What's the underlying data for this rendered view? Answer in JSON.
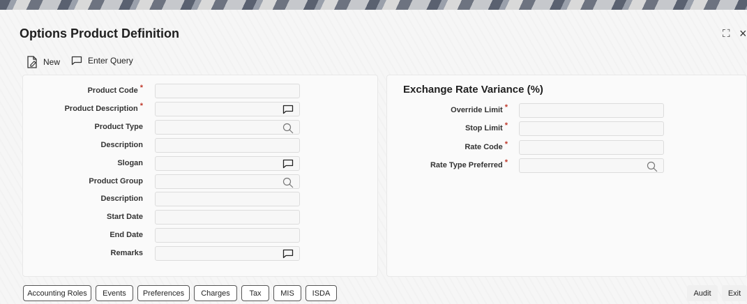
{
  "window": {
    "title": "Options Product Definition",
    "maximize_glyph": "⛶",
    "close_glyph": "×"
  },
  "toolbar": {
    "new_label": "New",
    "enter_query_label": "Enter Query"
  },
  "left_panel": {
    "fields": [
      {
        "label": "Product Code",
        "required": true,
        "icon": null
      },
      {
        "label": "Product Description",
        "required": true,
        "icon": "comment-icon"
      },
      {
        "label": "Product Type",
        "required": false,
        "icon": "search-icon"
      },
      {
        "label": "Description",
        "required": false,
        "icon": null
      },
      {
        "label": "Slogan",
        "required": false,
        "icon": "comment-icon"
      },
      {
        "label": "Product Group",
        "required": false,
        "icon": "search-icon"
      },
      {
        "label": "Description",
        "required": false,
        "icon": null
      },
      {
        "label": "Start Date",
        "required": false,
        "icon": null
      },
      {
        "label": "End Date",
        "required": false,
        "icon": null
      },
      {
        "label": "Remarks",
        "required": false,
        "icon": "comment-icon"
      }
    ]
  },
  "right_panel": {
    "section_title": "Exchange Rate Variance (%)",
    "fields": [
      {
        "label": "Override Limit",
        "required": true,
        "icon": null
      },
      {
        "label": "Stop Limit",
        "required": true,
        "icon": null
      },
      {
        "label": "Rate Code",
        "required": true,
        "icon": null
      },
      {
        "label": "Rate Type Preferred",
        "required": true,
        "icon": "search-icon"
      }
    ]
  },
  "required_marker": "*",
  "footer": {
    "tabs": [
      "Accounting Roles",
      "Events",
      "Preferences",
      "Charges",
      "Tax",
      "MIS",
      "ISDA"
    ],
    "audit_label": "Audit",
    "exit_label": "Exit"
  },
  "colors": {
    "required": "#c0392b",
    "button_border": "#555555"
  }
}
